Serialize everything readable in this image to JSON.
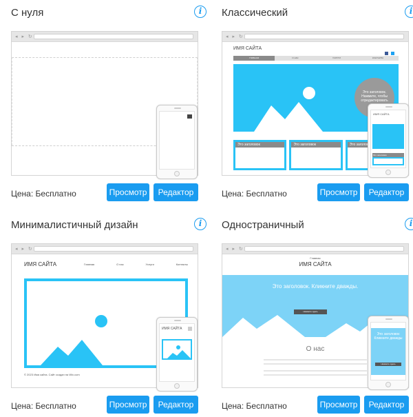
{
  "cards": [
    {
      "title": "С нуля",
      "price": "Цена: Бесплатно",
      "view_label": "Просмотр",
      "edit_label": "Редактор"
    },
    {
      "title": "Классический",
      "price": "Цена: Бесплатно",
      "view_label": "Просмотр",
      "edit_label": "Редактор",
      "site_name": "ИМЯ САЙТА",
      "nav": [
        "ГЛАВНАЯ",
        "О НАС",
        "УСЛУГИ",
        "КОНТАКТЫ"
      ],
      "bubble_text": "Это заголовок. Нажмите, чтобы отредактировать",
      "box_heading": "Это заголовок",
      "phone_site_name": "ИМЯ САЙТА",
      "phone_box_heading": "Это заголовок"
    },
    {
      "title": "Минималистичный дизайн",
      "price": "Цена: Бесплатно",
      "view_label": "Просмотр",
      "edit_label": "Редактор",
      "site_name": "ИМЯ САЙТА",
      "nav": [
        "Главная",
        "О нас",
        "Услуги",
        "Контакты"
      ],
      "footer_text": "© 2023 Имя сайта. Сайт создан на Wix.com",
      "phone_site_name": "ИМЯ САЙТА"
    },
    {
      "title": "Одностраничный",
      "price": "Цена: Бесплатно",
      "view_label": "Просмотр",
      "edit_label": "Редактор",
      "top_link": "Главная",
      "site_name": "ИМЯ САЙТА",
      "hero_heading": "Это заголовок. Кликните дважды.",
      "hero_button": "Нажмите здесь",
      "about_heading": "О нас",
      "phone_hero_heading": "Это заголовок Кликните дважды",
      "phone_button": "Нажмите здесь"
    }
  ],
  "colors": {
    "accent": "#1a9cf0",
    "preview_blue": "#29c3f6",
    "frame": "#d4d4d4"
  },
  "icons": {
    "info": "info-icon"
  },
  "info_glyph": "i"
}
